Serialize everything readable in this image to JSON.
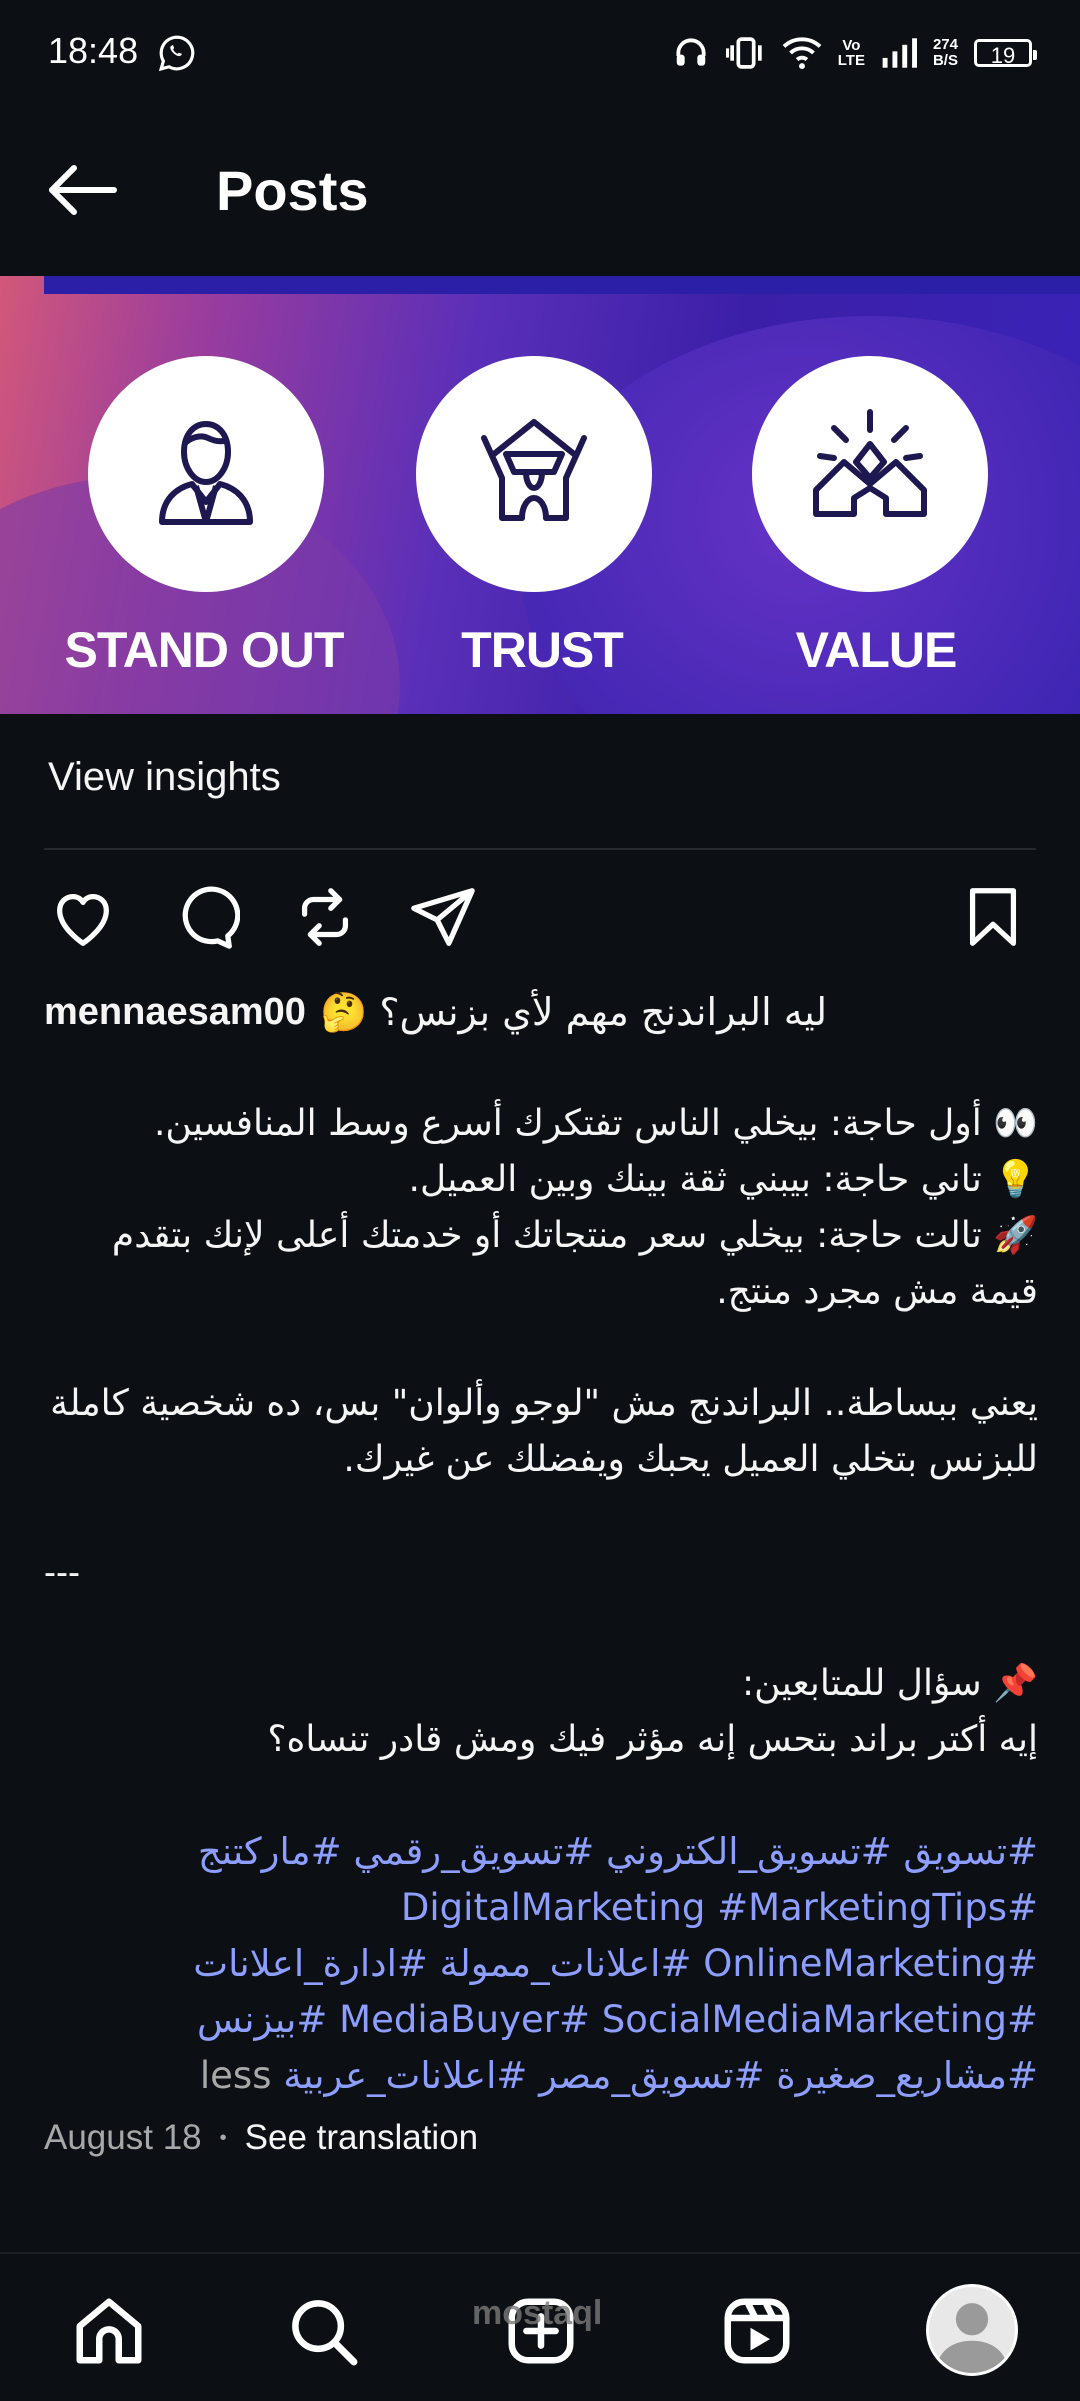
{
  "status_bar": {
    "time": "18:48",
    "net_speed_top": "274",
    "net_speed_bottom": "B/S",
    "volte_top": "Vo",
    "volte_bottom": "LTE",
    "battery": "19"
  },
  "header": {
    "title": "Posts"
  },
  "banner": {
    "labels": [
      "STAND OUT",
      "TRUST",
      "VALUE"
    ]
  },
  "insights": {
    "label": "View insights"
  },
  "caption": {
    "username": "mennaesam00",
    "title_line": "ليه البراندنج مهم لأي بزنس؟ 🤔",
    "lines": [
      "👀 أول حاجة: بيخلي الناس تفتكرك أسرع وسط المنافسين.",
      "💡 تاني حاجة: بيبني ثقة بينك وبين العميل.",
      "🚀 تالت حاجة: بيخلي سعر منتجاتك أو خدمتك أعلى لإنك بتقدم",
      "قيمة مش مجرد منتج."
    ],
    "summary_lines": [
      "يعني ببساطة.. البراندنج مش \"لوجو وألوان\" بس، ده شخصية كاملة",
      "للبزنس بتخلي العميل يحبك ويفضلك عن غيرك."
    ],
    "separator": "---",
    "question_lines": [
      "📌 سؤال للمتابعين:",
      "إيه أكتر براند بتحس إنه مؤثر فيك ومش قادر تنساه؟"
    ],
    "hashtag_lines": [
      "#تسويق #تسويق_الكتروني #تسويق_رقمي #ماركتنج",
      "#DigitalMarketing #MarketingTips",
      "#OnlineMarketing #اعلانات_ممولة #ادارة_اعلانات",
      "#MediaBuyer# SocialMediaMarketing #بيزنس",
      "#مشاريع_صغيرة #تسويق_مصر #اعلانات_عربية"
    ],
    "less_label": "less"
  },
  "meta": {
    "date": "August 18",
    "separator_dot": "•",
    "see_translation": "See translation"
  },
  "watermark": "mostaql",
  "colors": {
    "background": "#0c1014",
    "hashtag": "#8d9eff",
    "muted": "#a8a8a8"
  }
}
